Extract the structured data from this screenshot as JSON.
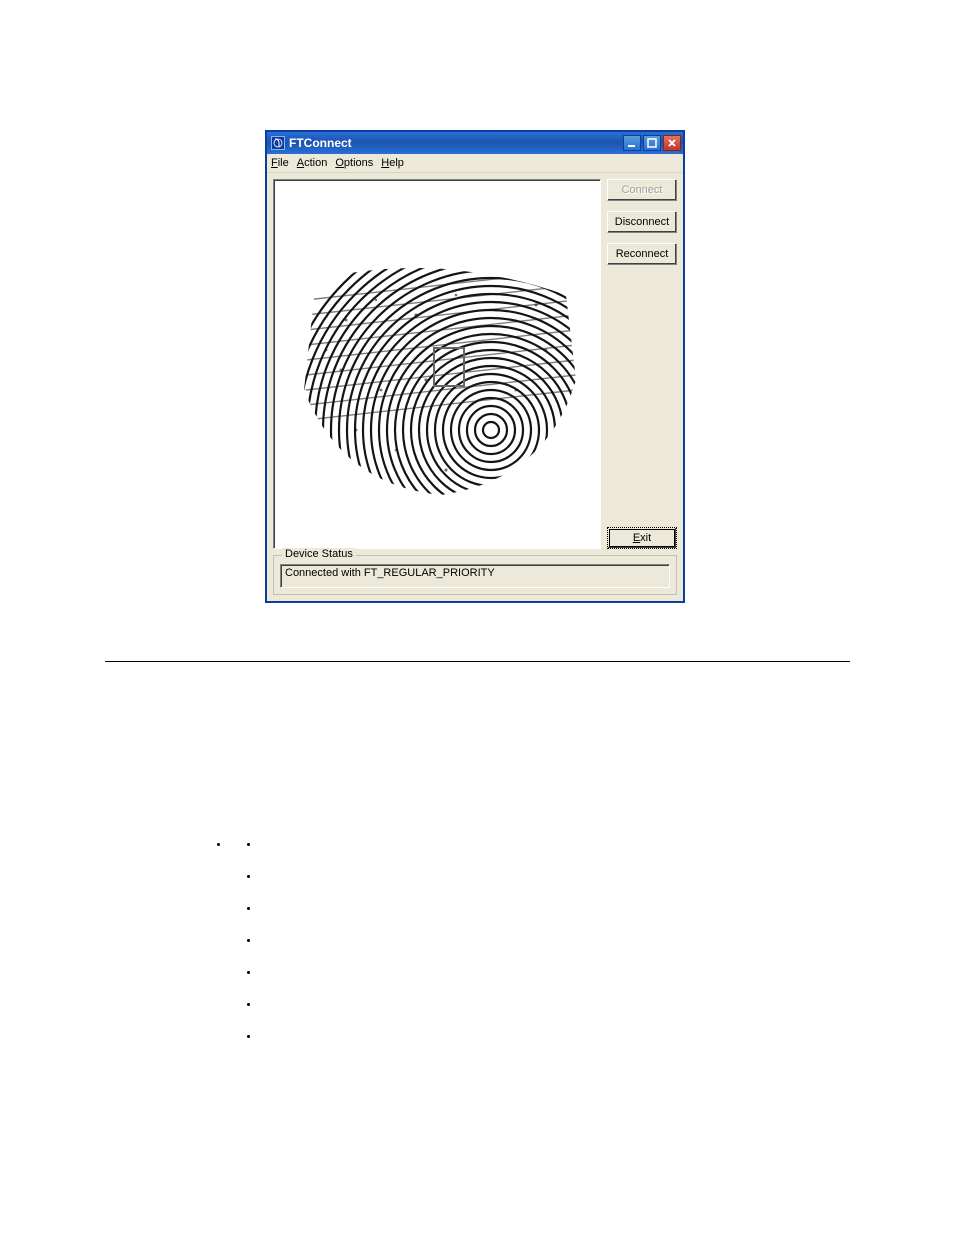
{
  "window": {
    "title": "FTConnect",
    "menu": {
      "file": "File",
      "action": "Action",
      "options": "Options",
      "help": "Help"
    },
    "buttons": {
      "connect": "Connect",
      "disconnect": "Disconnect",
      "reconnect": "Reconnect",
      "exit": "Exit"
    },
    "status_group_label": "Device Status",
    "status_text": "Connected with FT_REGULAR_PRIORITY"
  }
}
